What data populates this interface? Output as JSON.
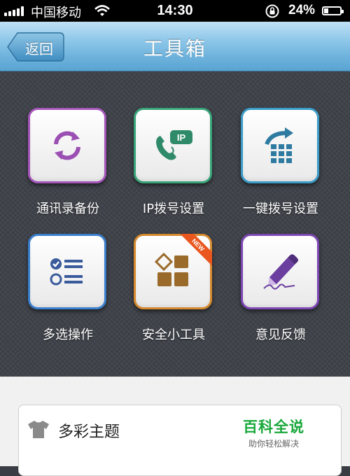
{
  "status_bar": {
    "carrier": "中国移动",
    "time": "14:30",
    "battery": "24%",
    "battery_level": 0.24
  },
  "header": {
    "back_label": "返回",
    "title": "工具箱"
  },
  "tools": [
    {
      "label": "通讯录备份",
      "icon": "sync-icon",
      "border_color": "#a455b9"
    },
    {
      "label": "IP拨号设置",
      "icon": "phone-ip-icon",
      "border_color": "#38a378"
    },
    {
      "label": "一键拨号设置",
      "icon": "grid-share-icon",
      "border_color": "#3a9bc7"
    },
    {
      "label": "多选操作",
      "icon": "checklist-icon",
      "border_color": "#3a7fcc"
    },
    {
      "label": "安全小工具",
      "icon": "tools-blocks-icon",
      "border_color": "#d4892f",
      "badge": "NEW"
    },
    {
      "label": "意见反馈",
      "icon": "pencil-sign-icon",
      "border_color": "#7c46b3"
    }
  ],
  "list": {
    "items": [
      {
        "label": "多彩主题",
        "icon": "tshirt-icon"
      }
    ]
  },
  "watermark": {
    "title": "百科全说",
    "subtitle": "助你轻松解决"
  },
  "colors": {
    "accent_green": "#19a83b",
    "nav_blue": "#6fb3dd",
    "tile_icon_purple": "#9b4fb3",
    "tile_icon_teal": "#2f8a6a",
    "tile_icon_blue": "#2f7aa1",
    "tile_icon_brown": "#9a6a2a"
  }
}
